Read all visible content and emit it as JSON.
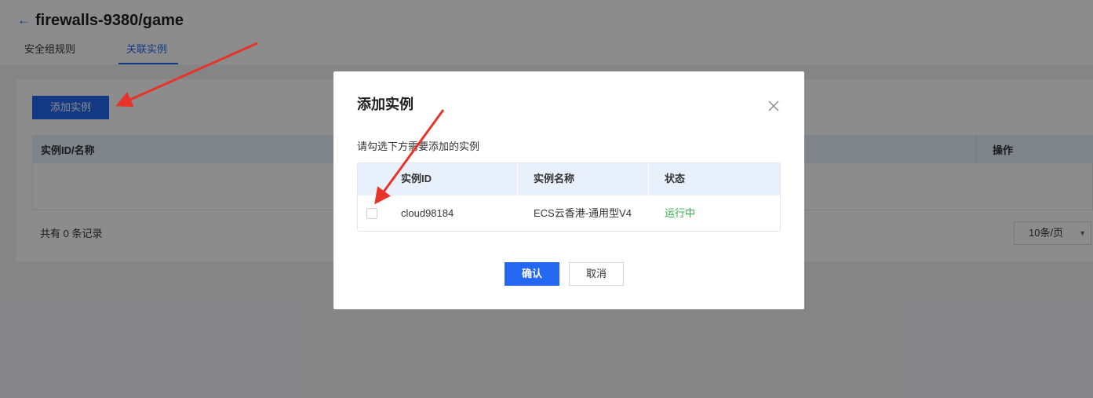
{
  "header": {
    "title": "firewalls-9380/game",
    "back_icon": "arrow-left-icon",
    "tabs": [
      {
        "label": "安全组规则",
        "active": false
      },
      {
        "label": "关联实例",
        "active": true
      }
    ]
  },
  "main": {
    "add_button_label": "添加实例",
    "table": {
      "columns": [
        "实例ID/名称",
        "操作"
      ]
    },
    "total_text": "共有 0 条记录",
    "page_size": "10条/页"
  },
  "modal": {
    "title": "添加实例",
    "close_icon": "close-icon",
    "hint": "请勾选下方需要添加的实例",
    "columns": [
      "实例ID",
      "实例名称",
      "状态"
    ],
    "rows": [
      {
        "id": "cloud98184",
        "name": "ECS云香港-通用型V4",
        "status": "运行中",
        "checked": false
      }
    ],
    "confirm_label": "确认",
    "cancel_label": "取消"
  },
  "colors": {
    "accent": "#2468f2",
    "status_running": "#2fb048",
    "annotation_arrow": "#e8332b"
  }
}
